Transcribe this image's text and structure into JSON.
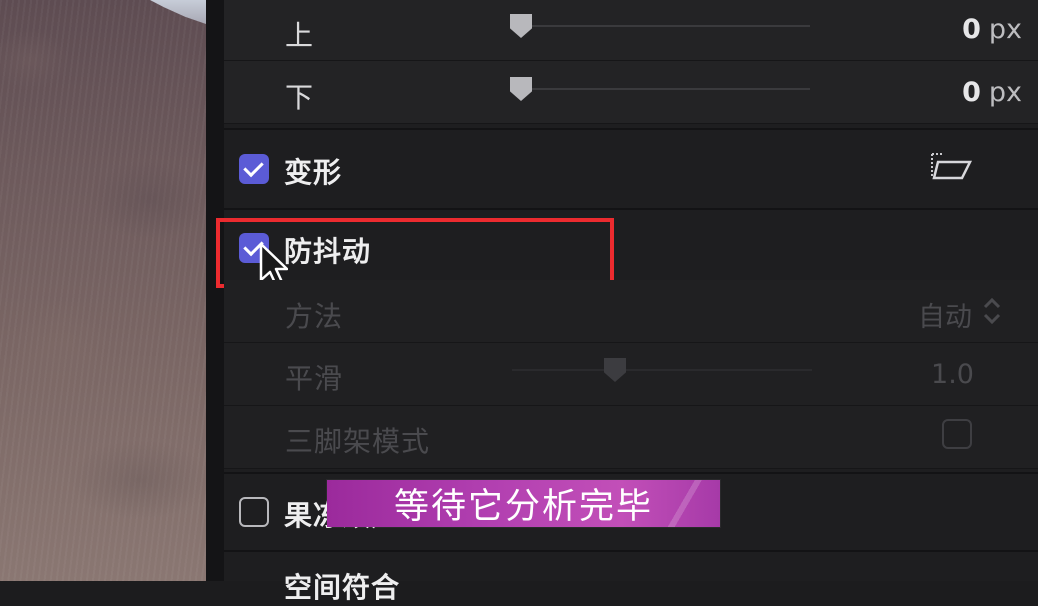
{
  "crop": {
    "top_label": "上",
    "top_value": "0",
    "bottom_label": "下",
    "bottom_value": "0",
    "unit": "px"
  },
  "transform": {
    "label": "变形",
    "checked": true
  },
  "stabilization": {
    "label": "防抖动",
    "checked": true,
    "method_label": "方法",
    "method_value": "自动",
    "smoothing_label": "平滑",
    "smoothing_value": "1.0",
    "tripod_label": "三脚架模式",
    "tripod_checked": false
  },
  "rolling_shutter": {
    "label": "果冻效应",
    "checked": false
  },
  "next_section_label": "空间符合",
  "caption": "等待它分析完毕",
  "colors": {
    "accent": "#5b5bd6",
    "highlight": "#ec2b2f",
    "caption_bg": "#b13fb0"
  }
}
